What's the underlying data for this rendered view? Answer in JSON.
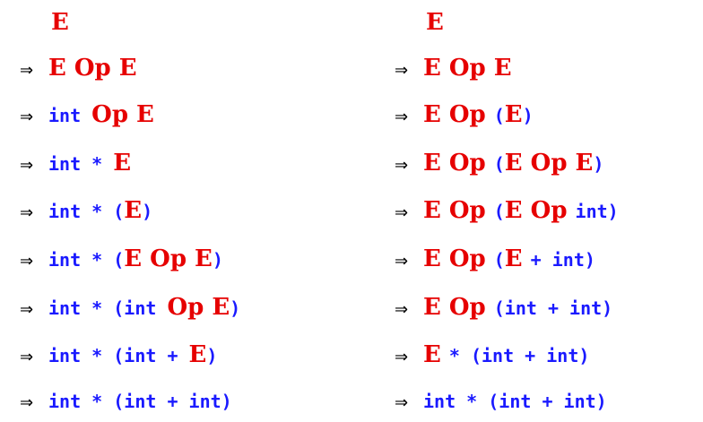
{
  "arrow": "⇒",
  "left": {
    "start": "E",
    "steps": [
      [
        {
          "t": "nt",
          "v": "E Op E"
        }
      ],
      [
        {
          "t": "t",
          "v": "int "
        },
        {
          "t": "nt",
          "v": "Op E"
        }
      ],
      [
        {
          "t": "t",
          "v": "int * "
        },
        {
          "t": "nt",
          "v": "E"
        }
      ],
      [
        {
          "t": "t",
          "v": "int * ("
        },
        {
          "t": "nt",
          "v": "E"
        },
        {
          "t": "t",
          "v": ")"
        }
      ],
      [
        {
          "t": "t",
          "v": "int * ("
        },
        {
          "t": "nt",
          "v": "E Op E"
        },
        {
          "t": "t",
          "v": ")"
        }
      ],
      [
        {
          "t": "t",
          "v": "int * (int "
        },
        {
          "t": "nt",
          "v": "Op E"
        },
        {
          "t": "t",
          "v": ")"
        }
      ],
      [
        {
          "t": "t",
          "v": "int * (int + "
        },
        {
          "t": "nt",
          "v": "E"
        },
        {
          "t": "t",
          "v": ")"
        }
      ],
      [
        {
          "t": "t",
          "v": "int * (int + int)"
        }
      ]
    ]
  },
  "right": {
    "start": "E",
    "steps": [
      [
        {
          "t": "nt",
          "v": "E Op E"
        }
      ],
      [
        {
          "t": "nt",
          "v": "E Op "
        },
        {
          "t": "t",
          "v": "("
        },
        {
          "t": "nt",
          "v": "E"
        },
        {
          "t": "t",
          "v": ")"
        }
      ],
      [
        {
          "t": "nt",
          "v": "E Op "
        },
        {
          "t": "t",
          "v": "("
        },
        {
          "t": "nt",
          "v": "E Op E"
        },
        {
          "t": "t",
          "v": ")"
        }
      ],
      [
        {
          "t": "nt",
          "v": "E Op "
        },
        {
          "t": "t",
          "v": "("
        },
        {
          "t": "nt",
          "v": "E Op "
        },
        {
          "t": "t",
          "v": "int)"
        }
      ],
      [
        {
          "t": "nt",
          "v": "E Op "
        },
        {
          "t": "t",
          "v": "("
        },
        {
          "t": "nt",
          "v": "E "
        },
        {
          "t": "t",
          "v": "+ int)"
        }
      ],
      [
        {
          "t": "nt",
          "v": "E Op "
        },
        {
          "t": "t",
          "v": "(int + int)"
        }
      ],
      [
        {
          "t": "nt",
          "v": "E "
        },
        {
          "t": "t",
          "v": "* (int + int)"
        }
      ],
      [
        {
          "t": "t",
          "v": "int * (int + int)"
        }
      ]
    ]
  }
}
